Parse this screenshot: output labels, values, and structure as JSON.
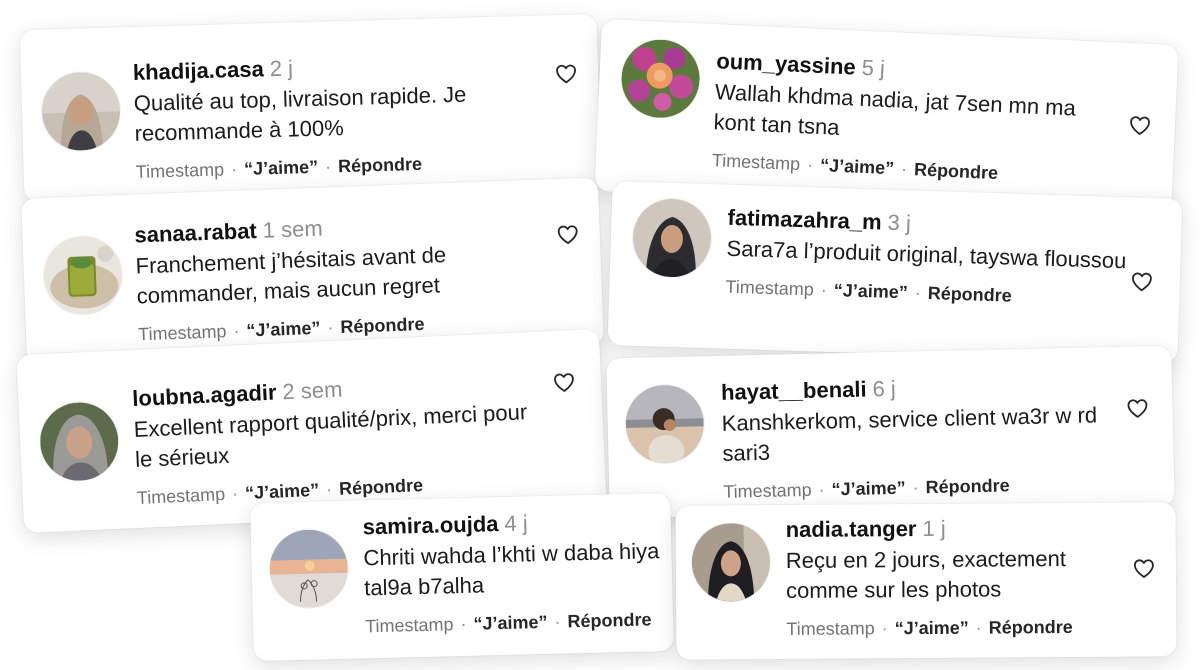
{
  "actions": {
    "timestamp_label": "Timestamp",
    "like_label": "“J’aime”",
    "reply_label": "Répondre",
    "separator": "·"
  },
  "comments": [
    {
      "username": "khadija.casa",
      "age": "2 j",
      "text": "Qualité au top, livraison rapide. Je recommande à 100%"
    },
    {
      "username": "oum_yassine",
      "age": "5 j",
      "text": "Wallah khdma nadia, jat 7sen mn ma kont tan tsna"
    },
    {
      "username": "sanaa.rabat",
      "age": "1 sem",
      "text": "Franchement j’hésitais avant de commander, mais aucun regret"
    },
    {
      "username": "fatimazahra_m",
      "age": "3 j",
      "text": "Sara7a l’produit original, tayswa floussou"
    },
    {
      "username": "loubna.agadir",
      "age": "2 sem",
      "text": "Excellent rapport qualité/prix, merci pour le sérieux"
    },
    {
      "username": "hayat__benali",
      "age": "6 j",
      "text": "Kanshkerkom, service client wa3r w rd sari3"
    },
    {
      "username": "samira.oujda",
      "age": "4 j",
      "text": "Chriti wahda l’khti w daba hiya tal9a b7alha"
    },
    {
      "username": "nadia.tanger",
      "age": "1 j",
      "text": "Reçu en 2 jours, exactement comme sur les photos"
    }
  ],
  "icons": {
    "like": "heart-outline-icon"
  },
  "colors": {
    "username": "#111111",
    "meta_gray": "#8e8e8e",
    "text": "#1b1b1b",
    "card_background": "#ffffff"
  }
}
